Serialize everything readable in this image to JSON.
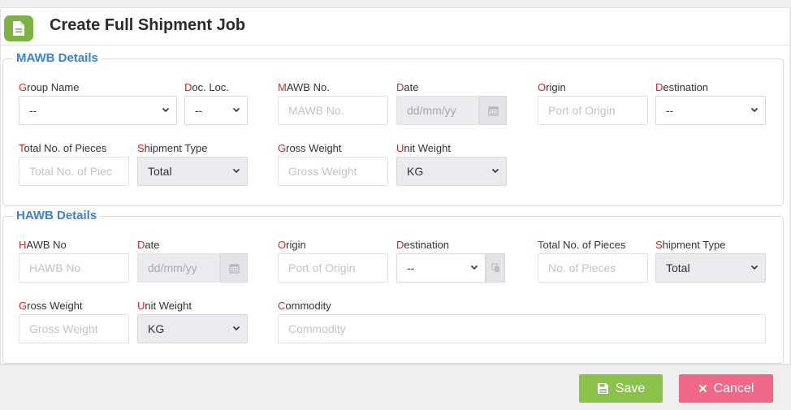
{
  "header": {
    "title": "Create Full Shipment Job",
    "icon": "document-icon"
  },
  "mawb": {
    "legend": "MAWB Details",
    "group_name": {
      "label_first": "G",
      "label_rest": "roup Name",
      "value": "--"
    },
    "doc_loc": {
      "label_first": "D",
      "label_rest": "oc. Loc.",
      "value": "--"
    },
    "mawb_no": {
      "label_first": "M",
      "label_rest": "AWB No.",
      "placeholder": "MAWB No."
    },
    "date": {
      "label_first": "D",
      "label_rest": "ate",
      "placeholder": "dd/mm/yy"
    },
    "origin": {
      "label_first": "O",
      "label_rest": "rigin",
      "placeholder": "Port of Origin"
    },
    "destination": {
      "label_first": "D",
      "label_rest": "estination",
      "value": "--"
    },
    "total_pieces": {
      "label_first": "T",
      "label_rest": "otal No. of Pieces",
      "placeholder": "Total No. of Piec"
    },
    "shipment_type": {
      "label_first": "S",
      "label_rest": "hipment Type",
      "value": "Total"
    },
    "gross_weight": {
      "label_first": "G",
      "label_rest": "ross Weight",
      "placeholder": "Gross Weight"
    },
    "unit_weight": {
      "label_first": "U",
      "label_rest": "nit Weight",
      "value": "KG"
    }
  },
  "hawb": {
    "legend": "HAWB Details",
    "hawb_no": {
      "label_first": "H",
      "label_rest": "AWB No",
      "placeholder": "HAWB No"
    },
    "date": {
      "label_first": "D",
      "label_rest": "ate",
      "placeholder": "dd/mm/yy"
    },
    "origin": {
      "label_first": "O",
      "label_rest": "rigin",
      "placeholder": "Port of Origin"
    },
    "destination": {
      "label_first": "D",
      "label_rest": "estination",
      "value": "--"
    },
    "total_pieces": {
      "label_first": "T",
      "label_rest": "otal No. of Pieces",
      "placeholder": "No. of Pieces"
    },
    "shipment_type": {
      "label_first": "S",
      "label_rest": "hipment Type",
      "value": "Total"
    },
    "gross_weight": {
      "label_first": "G",
      "label_rest": "ross Weight",
      "placeholder": "Gross Weight"
    },
    "unit_weight": {
      "label_first": "U",
      "label_rest": "nit Weight",
      "value": "KG"
    },
    "commodity": {
      "label_first": "C",
      "label_rest": "ommodity",
      "placeholder": "Commodity"
    }
  },
  "footer": {
    "save_label": "Save",
    "cancel_label": "Cancel"
  },
  "colors": {
    "accent_blue": "#3b82d6",
    "required_red": "#e02424",
    "save_green": "#8bc34a",
    "cancel_pink": "#f06888",
    "header_icon_green": "#7cb342"
  }
}
